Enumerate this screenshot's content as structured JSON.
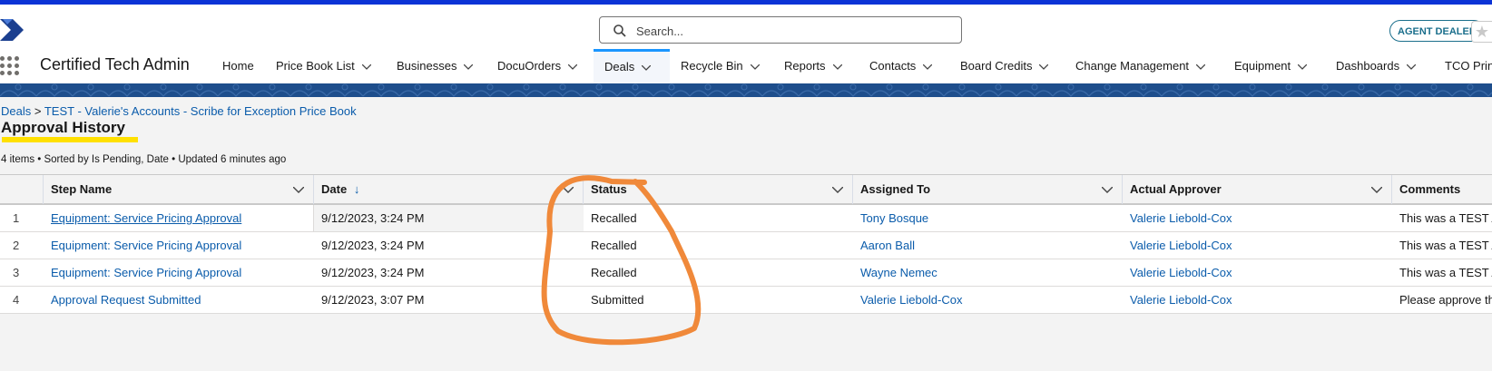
{
  "header": {
    "search_placeholder": "Search...",
    "agent_badge": "AGENT DEALER"
  },
  "app": {
    "name": "Certified Tech Admin"
  },
  "nav": {
    "items": [
      {
        "label": "Home"
      },
      {
        "label": "Price Book List"
      },
      {
        "label": "Businesses"
      },
      {
        "label": "DocuOrders"
      },
      {
        "label": "Deals"
      },
      {
        "label": "Recycle Bin"
      },
      {
        "label": "Reports"
      },
      {
        "label": "Contacts"
      },
      {
        "label": "Board Credits"
      },
      {
        "label": "Change Management"
      },
      {
        "label": "Equipment"
      },
      {
        "label": "Dashboards"
      },
      {
        "label": "TCO Printe"
      }
    ],
    "active": "Deals"
  },
  "breadcrumb": {
    "deals": "Deals",
    "separator": ">",
    "record": "TEST - Valerie's Accounts - Scribe for Exception Price Book"
  },
  "page": {
    "title": "Approval History",
    "info": "4 items • Sorted by Is Pending, Date • Updated 6 minutes ago"
  },
  "table": {
    "columns": [
      "Step Name",
      "Date",
      "Status",
      "Assigned To",
      "Actual Approver",
      "Comments"
    ],
    "sort_indicator": "↓",
    "rows": [
      {
        "num": "1",
        "step": "Equipment: Service Pricing Approval",
        "date": "9/12/2023, 3:24 PM",
        "status": "Recalled",
        "assigned": "Tony Bosque",
        "approver": "Valerie Liebold-Cox",
        "comments": "This was a TEST A"
      },
      {
        "num": "2",
        "step": "Equipment: Service Pricing Approval",
        "date": "9/12/2023, 3:24 PM",
        "status": "Recalled",
        "assigned": "Aaron Ball",
        "approver": "Valerie Liebold-Cox",
        "comments": "This was a TEST A"
      },
      {
        "num": "3",
        "step": "Equipment: Service Pricing Approval",
        "date": "9/12/2023, 3:24 PM",
        "status": "Recalled",
        "assigned": "Wayne Nemec",
        "approver": "Valerie Liebold-Cox",
        "comments": "This was a TEST A"
      },
      {
        "num": "4",
        "step": "Approval Request Submitted",
        "date": "9/12/2023, 3:07 PM",
        "status": "Submitted",
        "assigned": "Valerie Liebold-Cox",
        "approver": "Valerie Liebold-Cox",
        "comments": "Please approve th"
      }
    ]
  },
  "colors": {
    "top_accent": "#0b33d6",
    "link": "#0b5cab",
    "highlight": "#ffe000",
    "annotation": "#f0893a",
    "banner": "#1e4e8c"
  }
}
